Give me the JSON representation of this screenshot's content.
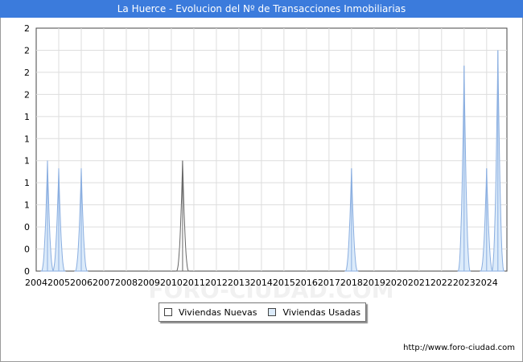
{
  "title": "La Huerce - Evolucion del Nº de Transacciones Inmobiliarias",
  "watermark": "FORO-CIUDAD.COM",
  "footer": "http://www.foro-ciudad.com",
  "legend": {
    "nuevas": {
      "label": "Viviendas Nuevas",
      "color": "#ffffff",
      "stroke": "#666666"
    },
    "usadas": {
      "label": "Viviendas Usadas",
      "color": "#dcebfa",
      "stroke": "#8aaee0"
    }
  },
  "chart_data": {
    "type": "area",
    "title": "La Huerce - Evolucion del Nº de Transacciones Inmobiliarias",
    "xlabel": "",
    "ylabel": "",
    "x_tick_labels": [
      "2004",
      "2005",
      "2006",
      "2007",
      "2008",
      "2009",
      "2010",
      "2011",
      "2012",
      "2013",
      "2014",
      "2015",
      "2016",
      "2017",
      "2018",
      "2019",
      "2020",
      "2021",
      "2022",
      "2023",
      "2024"
    ],
    "y_tick_labels": [
      "0",
      "0",
      "0",
      "1",
      "1",
      "1",
      "1",
      "1",
      "2",
      "2",
      "2",
      "2"
    ],
    "xlim": [
      2004,
      2024.9
    ],
    "ylim": [
      0,
      2.2
    ],
    "grid": true,
    "legend_position": "bottom",
    "series": [
      {
        "name": "Viviendas Usadas",
        "spikes": [
          {
            "x": 2004.5,
            "y": 1.0
          },
          {
            "x": 2005.0,
            "y": 0.93
          },
          {
            "x": 2006.0,
            "y": 0.93
          },
          {
            "x": 2018.0,
            "y": 0.93
          },
          {
            "x": 2023.0,
            "y": 1.86
          },
          {
            "x": 2024.0,
            "y": 0.93
          },
          {
            "x": 2024.5,
            "y": 2.0
          }
        ]
      },
      {
        "name": "Viviendas Nuevas",
        "spikes": [
          {
            "x": 2010.5,
            "y": 1.0
          }
        ]
      }
    ]
  }
}
